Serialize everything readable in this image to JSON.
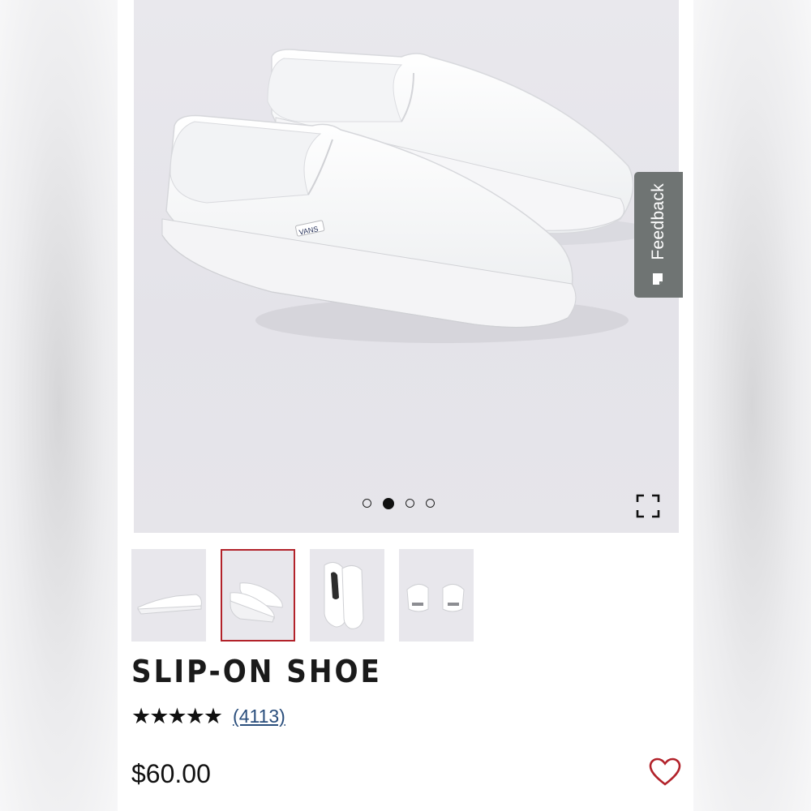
{
  "feedback": {
    "label": "Feedback",
    "icon": "feedback-icon"
  },
  "gallery": {
    "total_slides": 4,
    "active_slide": 2,
    "expand_icon": "fullscreen-icon",
    "thumbnails": [
      {
        "view": "side",
        "selected": false
      },
      {
        "view": "angle",
        "selected": true
      },
      {
        "view": "sole",
        "selected": false
      },
      {
        "view": "heel",
        "selected": false
      }
    ]
  },
  "product": {
    "title": "SLIP-ON SHOE",
    "rating": 4.5,
    "stars": "★★★★★",
    "review_count": "(4113)",
    "price": "$60.00"
  },
  "colors": {
    "accent": "#b2222a",
    "link": "#2a4e7c",
    "feedback_bg": "#6f7473"
  }
}
